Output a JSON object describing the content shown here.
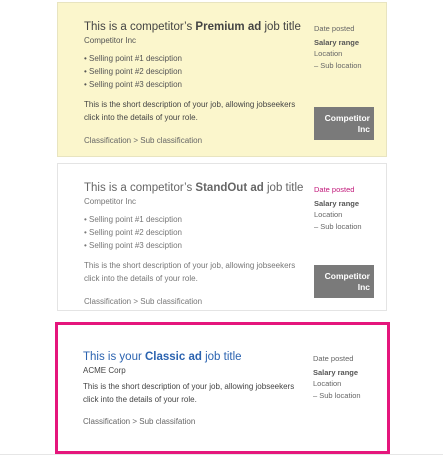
{
  "premium": {
    "title_prefix": "This is a competitor’s ",
    "title_bold": "Premium ad",
    "title_suffix": " job title",
    "company": "Competitor Inc",
    "points": [
      "Selling point #1 desciption",
      "Selling point #2 desciption",
      "Selling point #3 desciption"
    ],
    "description": "This is the short description of your job, allowing jobseekers click into the details of your role.",
    "classification": "Classification > Sub classification",
    "date_posted": "Date posted",
    "salary": "Salary range",
    "location": "Location",
    "sub_location": "– Sub location",
    "logo_line1": "Competitor",
    "logo_line2": "Inc",
    "colors": {
      "background": "#fbf6cc",
      "logo_bg": "#7a7a7a"
    }
  },
  "standout": {
    "title_prefix": "This is a competitor’s ",
    "title_bold": "StandOut ad",
    "title_suffix": " job title",
    "company": "Competitor Inc",
    "points": [
      "Selling point #1 desciption",
      "Selling point #2 desciption",
      "Selling point #3 desciption"
    ],
    "description": "This is the short description of your job, allowing jobseekers click into the details of your role.",
    "classification": "Classification > Sub classification",
    "date_posted": "Date posted",
    "salary": "Salary range",
    "location": "Location",
    "sub_location": "– Sub location",
    "logo_line1": "Competitor",
    "logo_line2": "Inc",
    "colors": {
      "date": "#c2187a"
    }
  },
  "classic": {
    "title_prefix": "This is your ",
    "title_bold": "Classic ad",
    "title_suffix": " job title",
    "company": "ACME Corp",
    "description": "This is the short description of your job, allowing jobseekers click into the details of your role.",
    "classification": "Classification > Sub classifation",
    "date_posted": "Date posted",
    "salary": "Salary range",
    "location": "Location",
    "sub_location": "– Sub location",
    "colors": {
      "border": "#e5167c",
      "title": "#2b63b0"
    }
  }
}
